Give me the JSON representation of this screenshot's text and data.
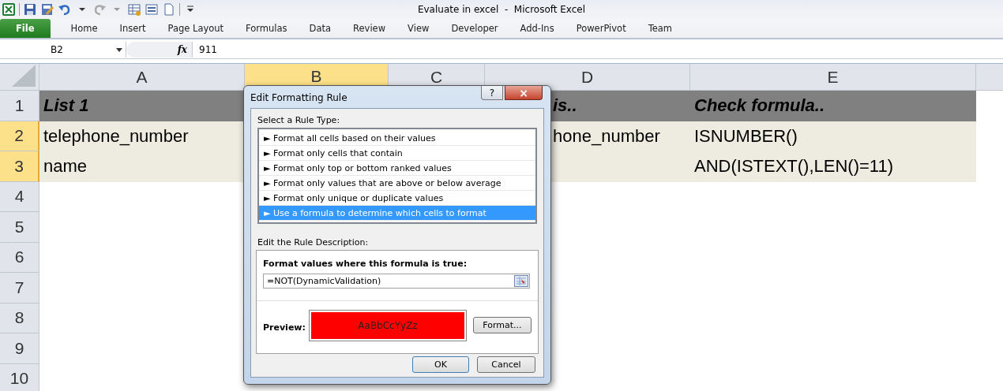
{
  "window": {
    "title": "Evaluate in excel  -  Microsoft Excel"
  },
  "ribbon_tabs": [
    {
      "label": "File",
      "selected": true
    },
    {
      "label": "Home",
      "selected": false
    },
    {
      "label": "Insert",
      "selected": false
    },
    {
      "label": "Page Layout",
      "selected": false
    },
    {
      "label": "Formulas",
      "selected": false
    },
    {
      "label": "Data",
      "selected": false
    },
    {
      "label": "Review",
      "selected": false
    },
    {
      "label": "View",
      "selected": false
    },
    {
      "label": "Developer",
      "selected": false
    },
    {
      "label": "Add-Ins",
      "selected": false
    },
    {
      "label": "PowerPivot",
      "selected": false
    },
    {
      "label": "Team",
      "selected": false
    }
  ],
  "formula_bar": {
    "name_box": "B2",
    "fx": "fx",
    "value": "911"
  },
  "columns": [
    {
      "label": "A",
      "selected": false
    },
    {
      "label": "B",
      "selected": true
    },
    {
      "label": "C",
      "selected": false
    },
    {
      "label": "D",
      "selected": false
    },
    {
      "label": "E",
      "selected": false
    }
  ],
  "rows": [
    {
      "label": "1",
      "selected": false,
      "kind": "header",
      "cells": [
        "List 1",
        "",
        "",
        "is..",
        "Check formula.."
      ]
    },
    {
      "label": "2",
      "selected": true,
      "kind": "data",
      "cells": [
        "telephone_number",
        "",
        "",
        "hone_number",
        "ISNUMBER()"
      ]
    },
    {
      "label": "3",
      "selected": true,
      "kind": "data",
      "cells": [
        "name",
        "",
        "",
        "",
        "AND(ISTEXT(),LEN()=11)"
      ]
    },
    {
      "label": "4",
      "selected": false,
      "kind": "empty"
    },
    {
      "label": "5",
      "selected": false,
      "kind": "empty"
    },
    {
      "label": "6",
      "selected": false,
      "kind": "empty"
    },
    {
      "label": "7",
      "selected": false,
      "kind": "empty"
    },
    {
      "label": "8",
      "selected": false,
      "kind": "empty"
    },
    {
      "label": "9",
      "selected": false,
      "kind": "empty"
    },
    {
      "label": "10",
      "selected": false,
      "kind": "empty"
    }
  ],
  "dialog": {
    "title": "Edit Formatting Rule",
    "help": "?",
    "close": "×",
    "rule_type_label": "Select a Rule Type:",
    "rule_types": [
      {
        "label": "► Format all cells based on their values",
        "selected": false
      },
      {
        "label": "► Format only cells that contain",
        "selected": false
      },
      {
        "label": "► Format only top or bottom ranked values",
        "selected": false
      },
      {
        "label": "► Format only values that are above or below average",
        "selected": false
      },
      {
        "label": "► Format only unique or duplicate values",
        "selected": false
      },
      {
        "label": "► Use a formula to determine which cells to format",
        "selected": true
      }
    ],
    "description_label": "Edit the Rule Description:",
    "formula_label": "Format values where this formula is true:",
    "formula": "=NOT(DynamicValidation)",
    "preview_label": "Preview:",
    "preview_sample": "AaBbCcYyZz",
    "format_button": "Format...",
    "ok": "OK",
    "cancel": "Cancel"
  }
}
